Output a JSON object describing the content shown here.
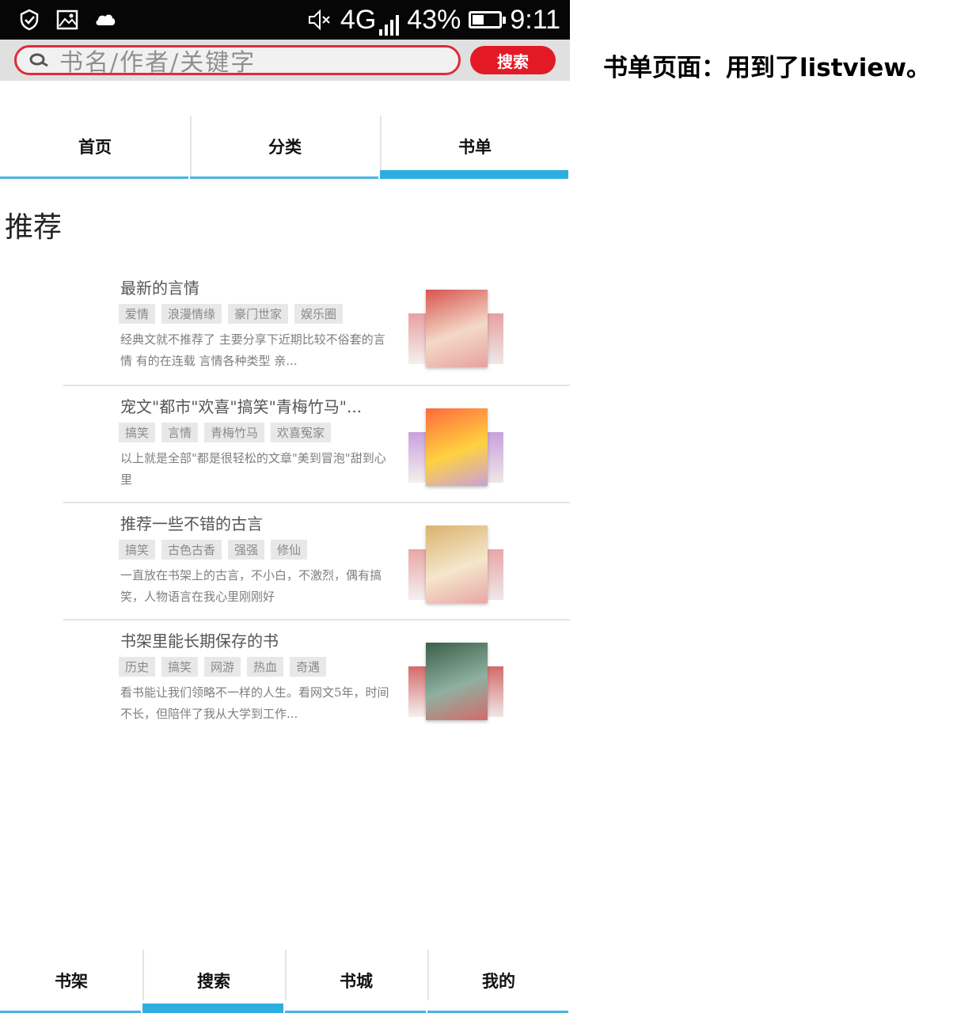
{
  "status_bar": {
    "network": "4G",
    "battery": "43%",
    "battery_level": 0.43,
    "time": "9:11",
    "left_icons": [
      "check-shield-icon",
      "image-icon",
      "cloud-icon"
    ],
    "sound_icon": "mute-icon"
  },
  "search": {
    "placeholder": "书名/作者/关键字",
    "button_label": "搜索",
    "accent": "#e31a25"
  },
  "top_tabs": [
    {
      "label": "首页",
      "active": false
    },
    {
      "label": "分类",
      "active": false
    },
    {
      "label": "书单",
      "active": true
    }
  ],
  "section_title": "推荐",
  "books": [
    {
      "title": "最新的言情",
      "tags": [
        "爱情",
        "浪漫情缘",
        "豪门世家",
        "娱乐圈"
      ],
      "desc": "经典文就不推荐了 主要分享下近期比较不俗套的言情 有的在连载 言情各种类型 亲...",
      "cover_colors": [
        "#d9534f",
        "#f3d9c8",
        "#e8a0a0"
      ]
    },
    {
      "title": "宠文\"都市\"欢喜\"搞笑\"青梅竹马\"...",
      "tags": [
        "搞笑",
        "言情",
        "青梅竹马",
        "欢喜冤家"
      ],
      "desc": "以上就是全部\"都是很轻松的文章\"美到冒泡\"甜到心里",
      "cover_colors": [
        "#ff6a3d",
        "#ffd23f",
        "#c9a0dc"
      ]
    },
    {
      "title": "推荐一些不错的古言",
      "tags": [
        "搞笑",
        "古色古香",
        "强强",
        "修仙"
      ],
      "desc": "一直放在书架上的古言，不小白，不激烈，偶有搞笑，人物语言在我心里刚刚好",
      "cover_colors": [
        "#d9b36c",
        "#f5e6cc",
        "#e9a6a6"
      ]
    },
    {
      "title": "书架里能长期保存的书",
      "tags": [
        "历史",
        "搞笑",
        "网游",
        "热血",
        "奇遇"
      ],
      "desc": "看书能让我们领略不一样的人生。看网文5年，时间不长，但陪伴了我从大学到工作...",
      "cover_colors": [
        "#3a5f4a",
        "#8fb0a0",
        "#d46a6a"
      ]
    }
  ],
  "bottom_nav": [
    {
      "label": "书架",
      "active": false
    },
    {
      "label": "搜索",
      "active": true
    },
    {
      "label": "书城",
      "active": false
    },
    {
      "label": "我的",
      "active": false
    }
  ],
  "tab_accent": "#2eaee0",
  "annotation": "书单页面：用到了listview。"
}
